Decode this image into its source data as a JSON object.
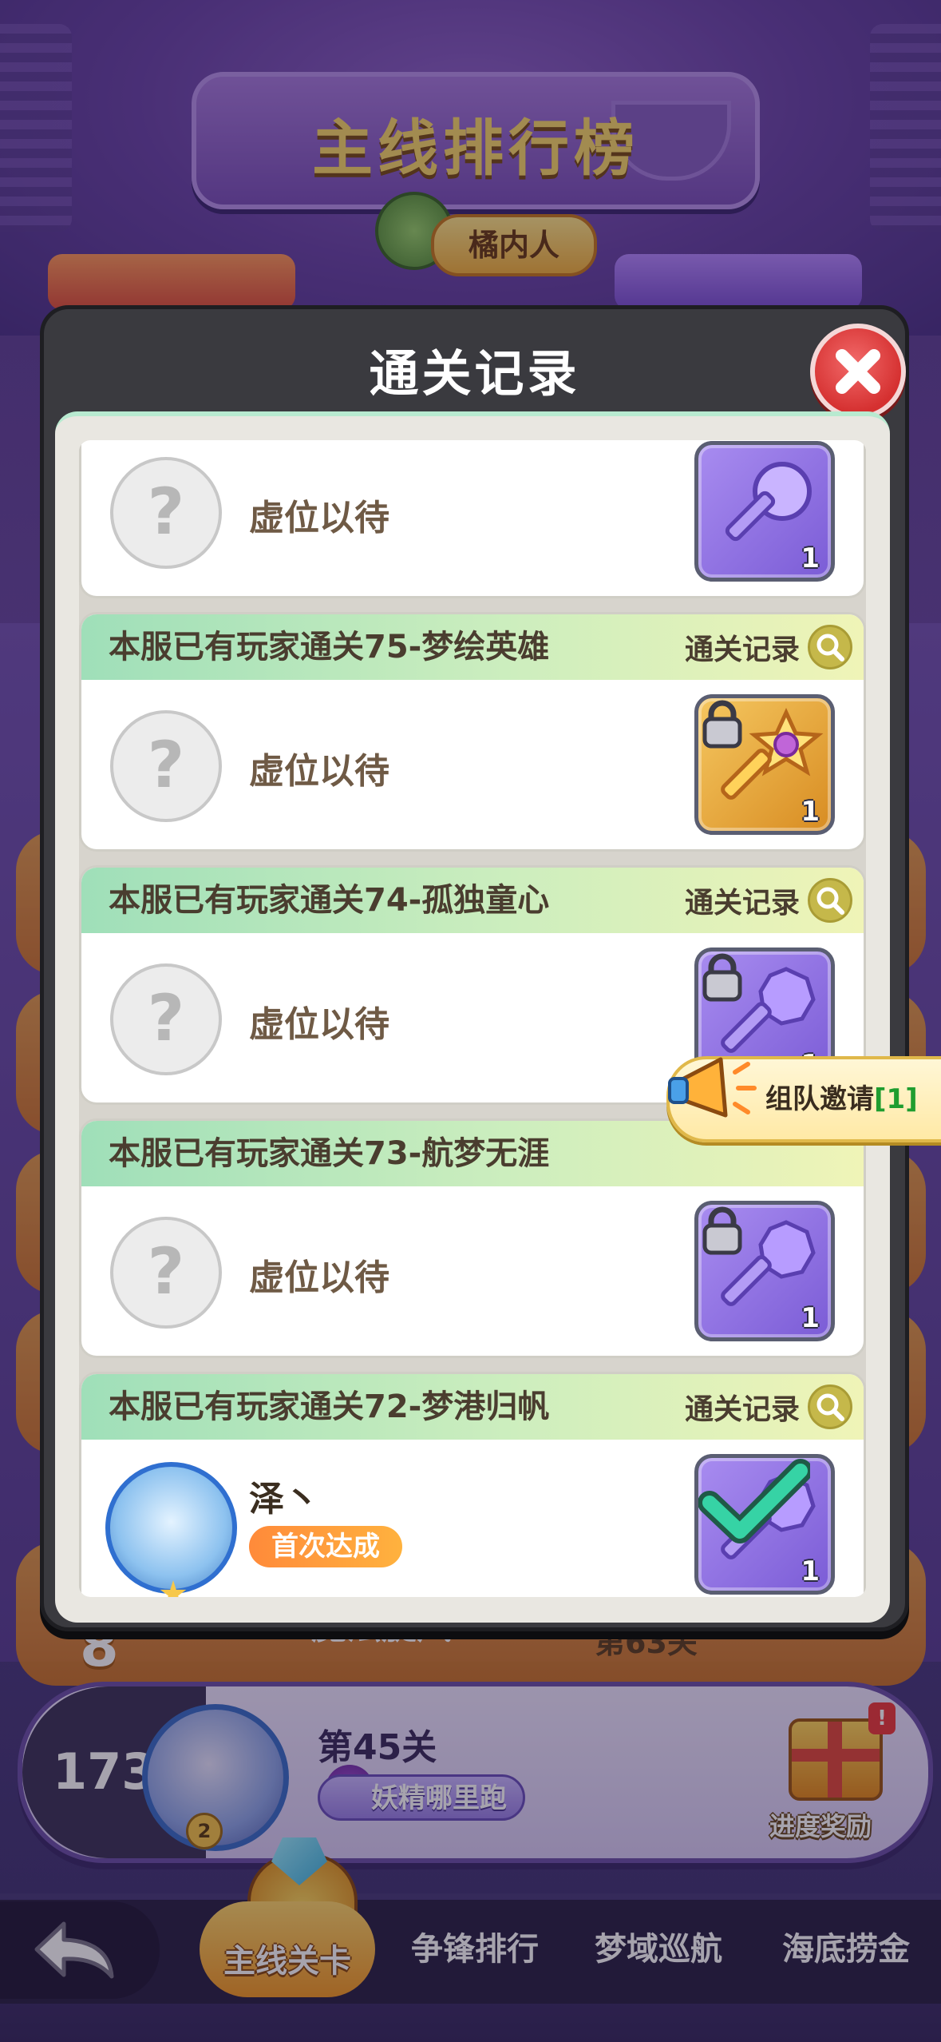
{
  "background": {
    "leaderboard_title": "主线排行榜",
    "top_player_name": "橘内人",
    "background_row_level": "第63关",
    "background_row_rank": "8",
    "background_row_title": "魔法旋风"
  },
  "modal": {
    "title": "通关记录",
    "close_label": "close",
    "records": [
      {
        "title": "",
        "status": "虚位以待",
        "key_color": "purple",
        "key_count": "1",
        "locked": true,
        "partial": true
      },
      {
        "title": "本服已有玩家通关75-梦绘英雄",
        "link_label": "通关记录",
        "status": "虚位以待",
        "key_color": "gold",
        "key_count": "1",
        "locked": true
      },
      {
        "title": "本服已有玩家通关74-孤独童心",
        "link_label": "通关记录",
        "status": "虚位以待",
        "key_color": "purple",
        "key_count": "1",
        "locked": true
      },
      {
        "title": "本服已有玩家通关73-航梦无涯",
        "link_label": "",
        "status": "虚位以待",
        "key_color": "purple",
        "key_count": "1",
        "locked": true
      },
      {
        "title": "本服已有玩家通关72-梦港归帆",
        "link_label": "通关记录",
        "player_name": "泽丶",
        "badge": "首次达成",
        "key_color": "purple",
        "key_count": "1",
        "completed": true
      }
    ]
  },
  "team_invite": {
    "label": "组队邀请",
    "count": "[1]"
  },
  "player_card": {
    "rank": "173",
    "level_badge": "2",
    "level": "第45关",
    "stage_name": "妖精哪里跑",
    "reward_label": "进度奖励",
    "reward_alert": "!"
  },
  "bottom_nav": {
    "back_label": "back",
    "tabs": [
      {
        "label": "主线关卡",
        "active": true
      },
      {
        "label": "争锋排行",
        "active": false
      },
      {
        "label": "梦域巡航",
        "active": false
      },
      {
        "label": "海底捞金",
        "active": false
      }
    ]
  },
  "colors": {
    "modal_bg": "#3a3a3f",
    "card_header_start": "#9fdfb9",
    "card_header_end": "#f0f4b7",
    "close_button": "#d53030",
    "first_badge": "#ff8a3a",
    "invite_count": "#1f9d2f"
  }
}
